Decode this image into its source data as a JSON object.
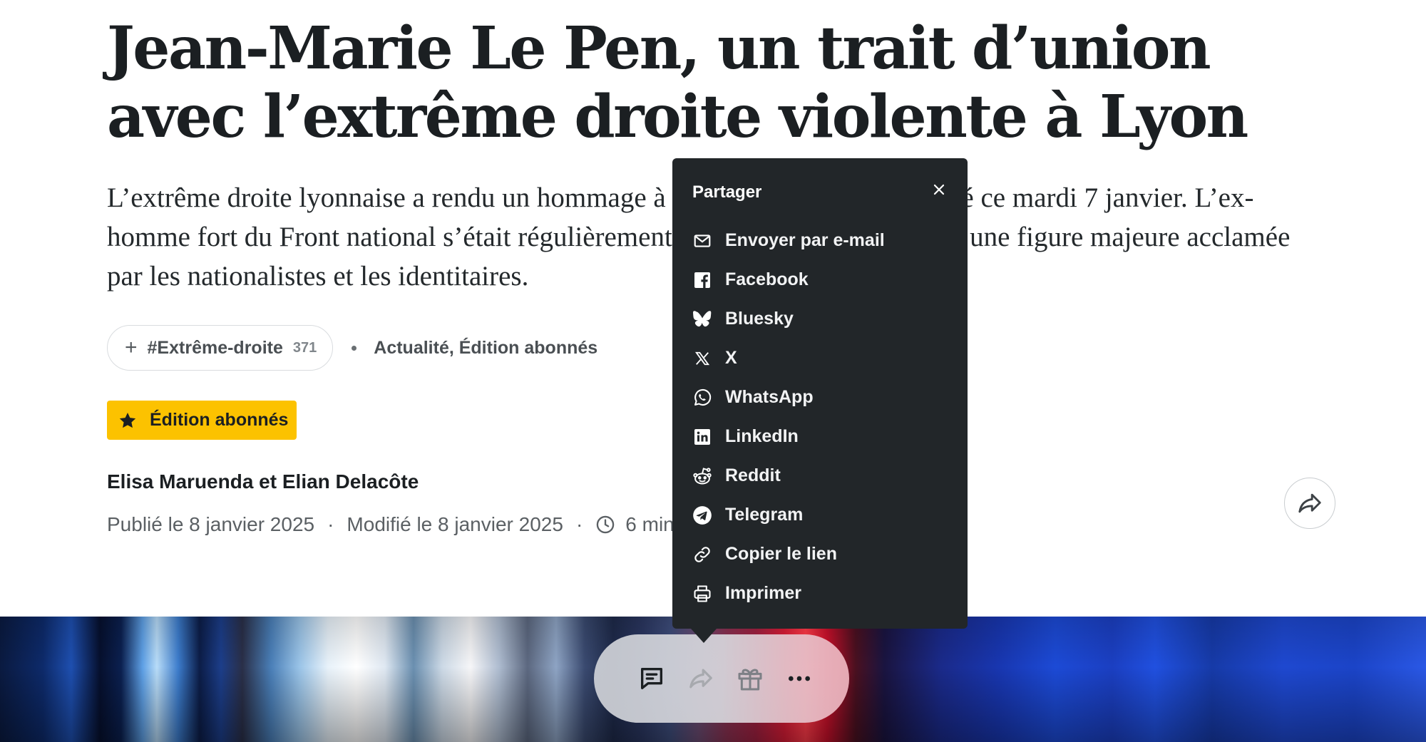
{
  "article": {
    "title": "Jean-Marie Le Pen, un trait d’union avec l’extrême droite violente à Lyon",
    "chapo": "L’extrême droite lyonnaise a rendu un hommage à Jean-Marie Le Pen, décédé ce mardi 7 janvier. L’ex-homme fort du Front national s’était régulièrement affiché à Lyon, où il reste une figure majeure acclamée par les nationalistes et les identitaires.",
    "tag": {
      "plus": "+",
      "name": "#Extrême-droite",
      "count": "371"
    },
    "rubrics": "Actualité, Édition abonnés",
    "badge": "Édition abonnés",
    "authors": "Elisa Maruenda et Elian Delacôte",
    "published": "Publié le 8 janvier 2025",
    "modified": "Modifié le 8 janvier 2025",
    "separator": "·",
    "reading_time": "6 min"
  },
  "share_popup": {
    "title": "Partager",
    "items": [
      {
        "label": "Envoyer par e-mail",
        "icon": "mail-icon"
      },
      {
        "label": "Facebook",
        "icon": "facebook-icon"
      },
      {
        "label": "Bluesky",
        "icon": "bluesky-icon"
      },
      {
        "label": "X",
        "icon": "x-icon"
      },
      {
        "label": "WhatsApp",
        "icon": "whatsapp-icon"
      },
      {
        "label": "LinkedIn",
        "icon": "linkedin-icon"
      },
      {
        "label": "Reddit",
        "icon": "reddit-icon"
      },
      {
        "label": "Telegram",
        "icon": "telegram-icon"
      },
      {
        "label": "Copier le lien",
        "icon": "link-icon"
      },
      {
        "label": "Imprimer",
        "icon": "printer-icon"
      }
    ]
  },
  "toolbar": {
    "buttons": [
      "comment-icon",
      "share-icon",
      "gift-icon",
      "more-icon"
    ]
  },
  "colors": {
    "badge_yellow": "#fcc200",
    "popup_bg": "#222629",
    "text_dark": "#1b1f22"
  }
}
